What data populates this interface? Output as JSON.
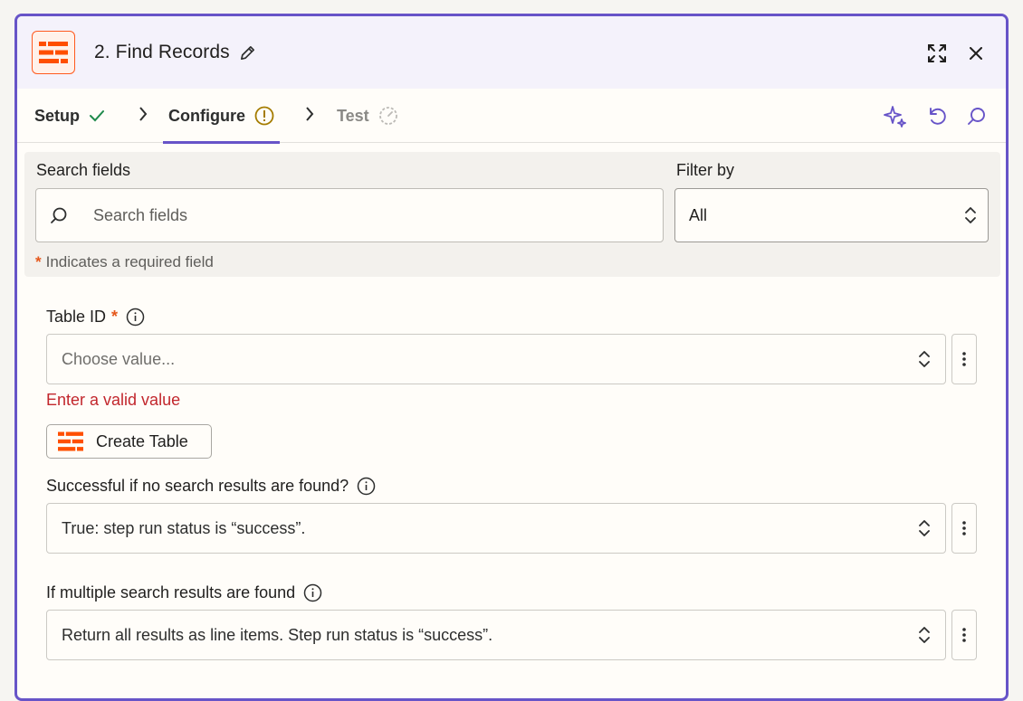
{
  "header": {
    "title": "2. Find Records",
    "accent": "#6754c8",
    "brand": "#ff4f00"
  },
  "tabs": [
    {
      "label": "Setup",
      "status": "check-icon"
    },
    {
      "label": "Configure",
      "status": "warning-icon"
    },
    {
      "label": "Test",
      "status": "timer-icon"
    }
  ],
  "search": {
    "label": "Search fields",
    "placeholder": "Search fields"
  },
  "filter": {
    "label": "Filter by",
    "value": "All"
  },
  "required_note": {
    "star": "*",
    "text": "Indicates a required field"
  },
  "fields": {
    "table_id": {
      "label": "Table ID",
      "required_star": "*",
      "placeholder": "Choose value...",
      "error": "Enter a valid value",
      "create_button": "Create Table"
    },
    "no_results": {
      "label": "Successful if no search results are found?",
      "value": "True: step run status is “success”."
    },
    "multiple_results": {
      "label": "If multiple search results are found",
      "value": "Return all results as line items. Step run status is “success”."
    }
  }
}
